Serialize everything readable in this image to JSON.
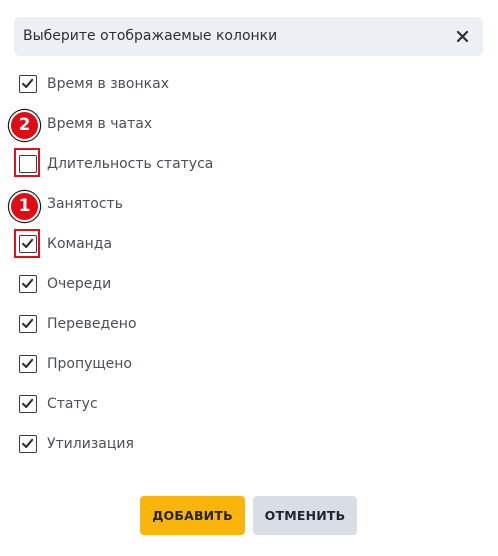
{
  "dialog": {
    "title": "Выберите отображаемые колонки",
    "close_icon": "close-icon"
  },
  "options": [
    {
      "label": "Время в звонках",
      "checked": true
    },
    {
      "label": "Время в чатах",
      "checked": true
    },
    {
      "label": "Длительность статуса",
      "checked": false
    },
    {
      "label": "Занятость",
      "checked": true
    },
    {
      "label": "Команда",
      "checked": true
    },
    {
      "label": "Очереди",
      "checked": true
    },
    {
      "label": "Переведено",
      "checked": true
    },
    {
      "label": "Пропущено",
      "checked": true
    },
    {
      "label": "Статус",
      "checked": true
    },
    {
      "label": "Утилизация",
      "checked": true
    }
  ],
  "annotations": [
    {
      "number": "1",
      "target": "Команда"
    },
    {
      "number": "2",
      "target": "Длительность статуса"
    }
  ],
  "buttons": {
    "add_label": "ДОБАВИТЬ",
    "cancel_label": "ОТМЕНИТЬ"
  },
  "colors": {
    "primary_button": "#fbb40a",
    "secondary_button": "#d9dde5",
    "header_background": "#eceff4",
    "annotation_red": "#e10c13"
  }
}
